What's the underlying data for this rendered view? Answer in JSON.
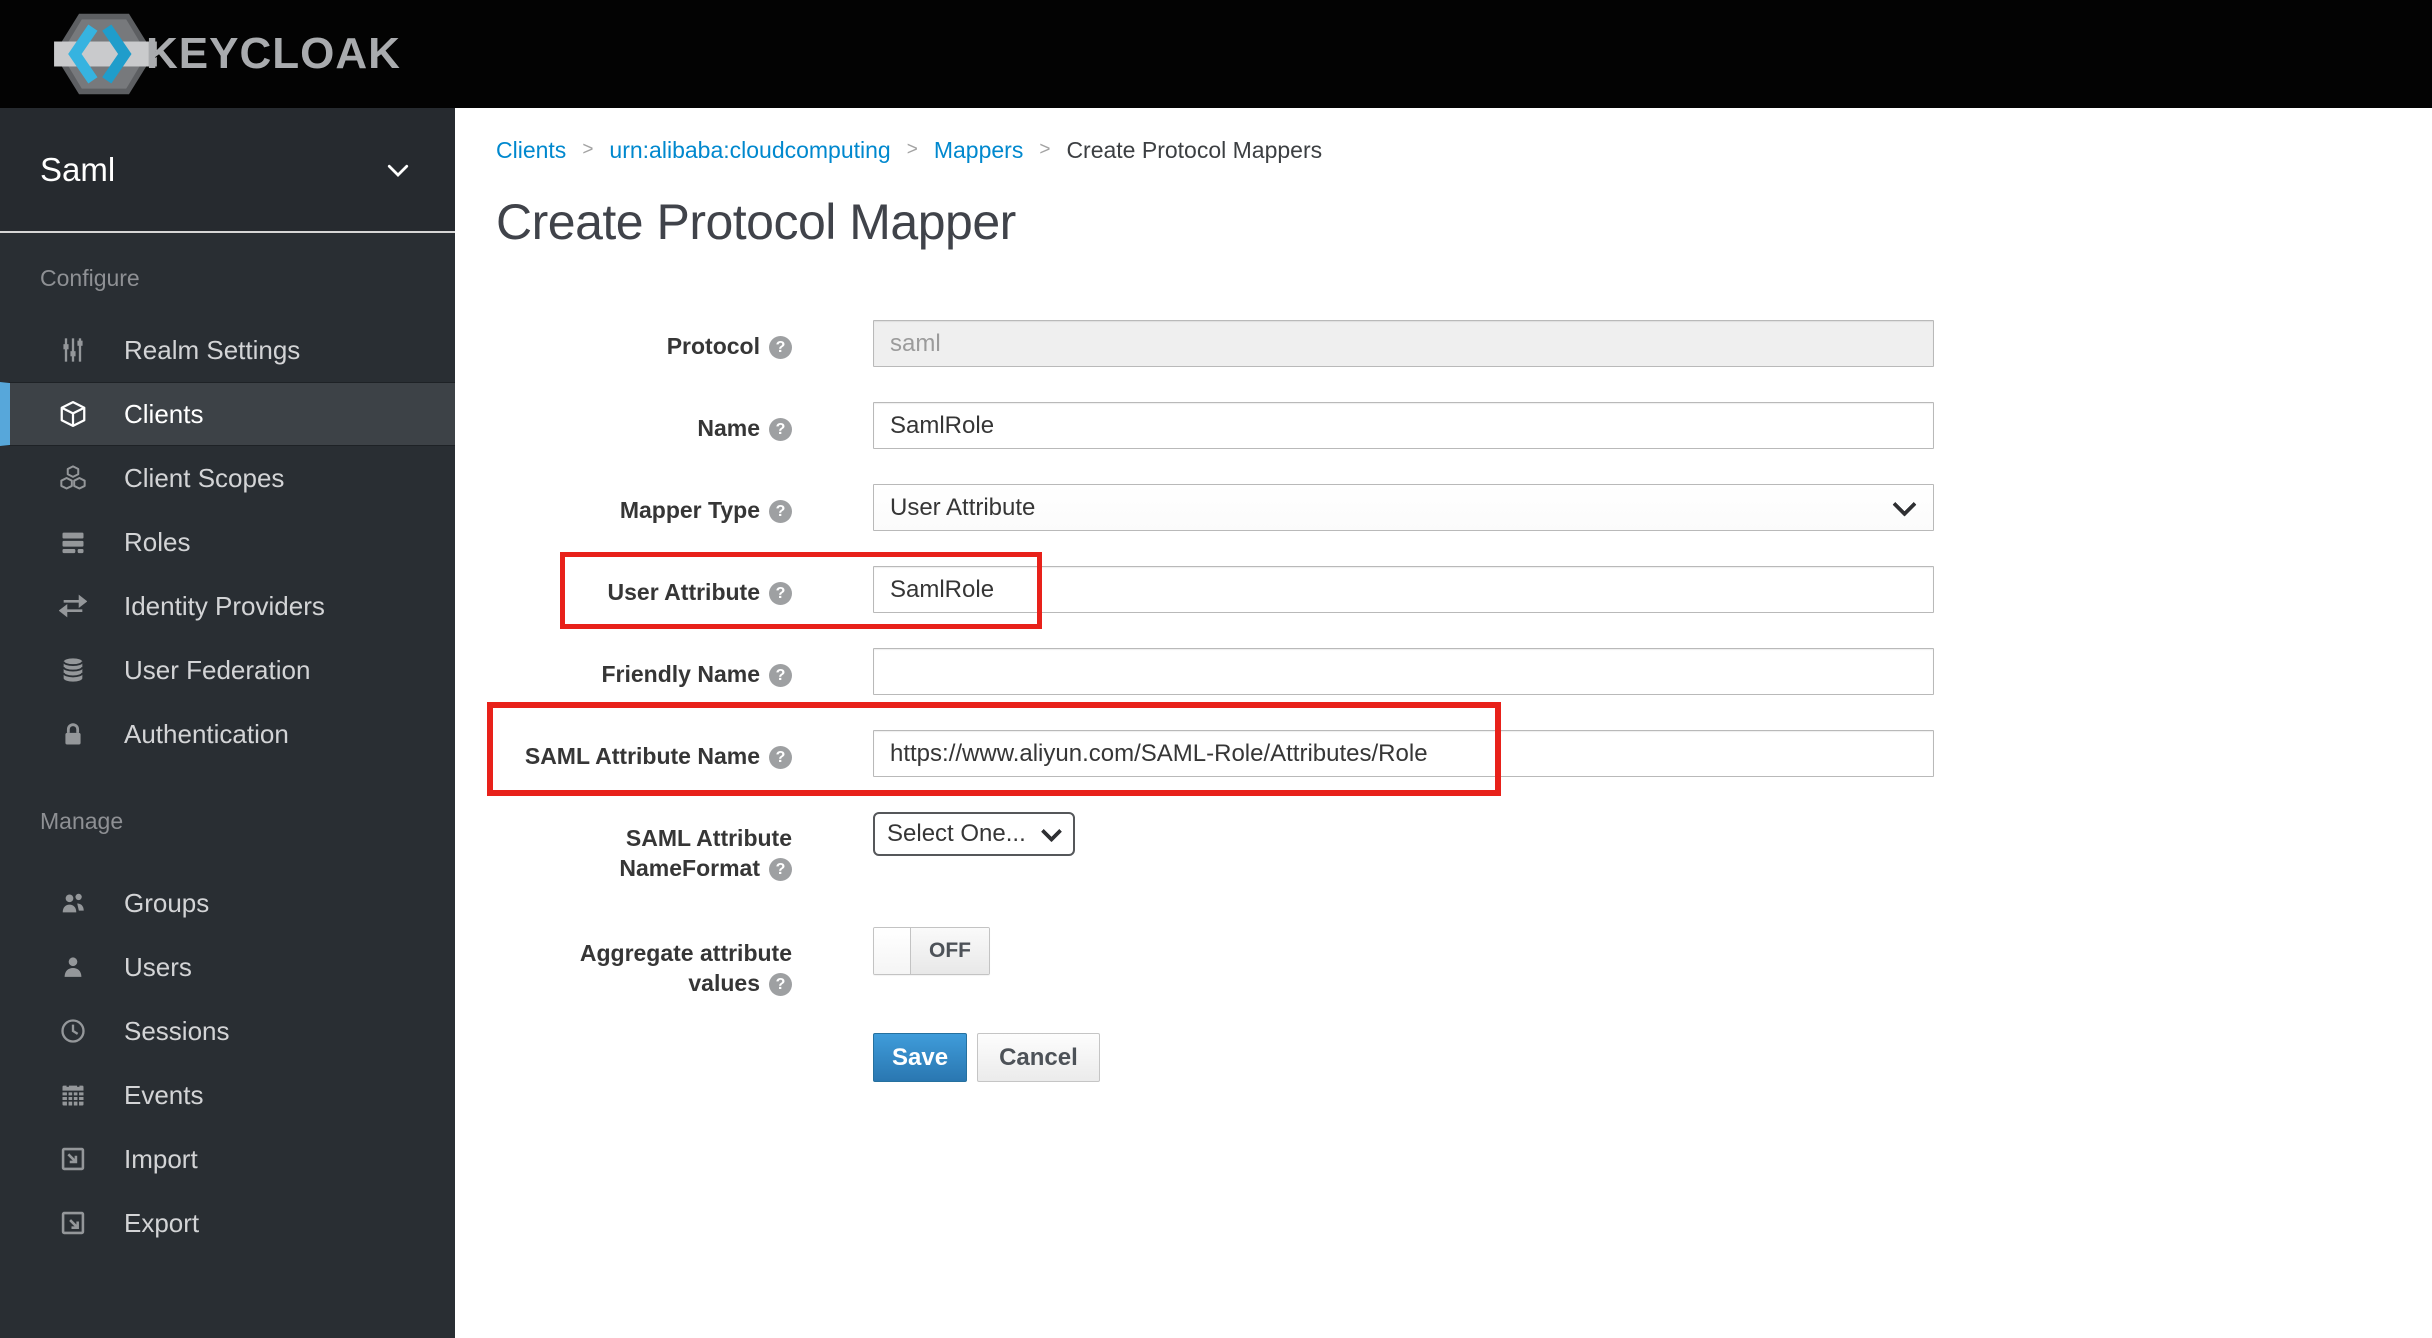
{
  "topbar": {
    "logo_text": "KEYCLOAK"
  },
  "sidebar": {
    "realm_name": "Saml",
    "configure_header": "Configure",
    "manage_header": "Manage",
    "configure_items": [
      {
        "label": "Realm Settings",
        "icon": "sliders-icon",
        "active": false
      },
      {
        "label": "Clients",
        "icon": "cube-icon",
        "active": true
      },
      {
        "label": "Client Scopes",
        "icon": "cubes-icon",
        "active": false
      },
      {
        "label": "Roles",
        "icon": "list-icon",
        "active": false
      },
      {
        "label": "Identity Providers",
        "icon": "exchange-arrows-icon",
        "active": false
      },
      {
        "label": "User Federation",
        "icon": "database-icon",
        "active": false
      },
      {
        "label": "Authentication",
        "icon": "lock-icon",
        "active": false
      }
    ],
    "manage_items": [
      {
        "label": "Groups",
        "icon": "users-icon",
        "active": false
      },
      {
        "label": "Users",
        "icon": "user-icon",
        "active": false
      },
      {
        "label": "Sessions",
        "icon": "clock-icon",
        "active": false
      },
      {
        "label": "Events",
        "icon": "calendar-icon",
        "active": false
      },
      {
        "label": "Import",
        "icon": "import-icon",
        "active": false
      },
      {
        "label": "Export",
        "icon": "export-icon",
        "active": false
      }
    ]
  },
  "breadcrumb": {
    "sep": ">",
    "links": [
      {
        "label": "Clients"
      },
      {
        "label": "urn:alibaba:cloudcomputing"
      },
      {
        "label": "Mappers"
      }
    ],
    "current": "Create Protocol Mappers"
  },
  "page_title": "Create Protocol Mapper",
  "icons": {
    "help": "?"
  },
  "form": {
    "protocol": {
      "label": "Protocol",
      "value": "saml",
      "disabled": true
    },
    "name": {
      "label": "Name",
      "value": "SamlRole"
    },
    "mapper_type": {
      "label": "Mapper Type",
      "value": "User Attribute"
    },
    "user_attribute": {
      "label": "User Attribute",
      "value": "SamlRole",
      "highlighted": true
    },
    "friendly_name": {
      "label": "Friendly Name",
      "value": ""
    },
    "saml_attribute_name": {
      "label": "SAML Attribute Name",
      "value": "https://www.aliyun.com/SAML-Role/Attributes/Role",
      "highlighted": true
    },
    "saml_attribute_nameformat": {
      "label_line1": "SAML Attribute",
      "label_line2": "NameFormat",
      "value": "Select One..."
    },
    "aggregate": {
      "label_line1": "Aggregate attribute",
      "label_line2": "values",
      "state": "OFF"
    },
    "save_label": "Save",
    "cancel_label": "Cancel"
  },
  "colors": {
    "topbar_bg": "#030303",
    "sidebar_bg": "#292e33",
    "sidebar_active_border": "#57a7da",
    "link_blue": "#0088ce",
    "highlight_red": "#e8211a",
    "save_button_blue": "#2e7cb5"
  }
}
